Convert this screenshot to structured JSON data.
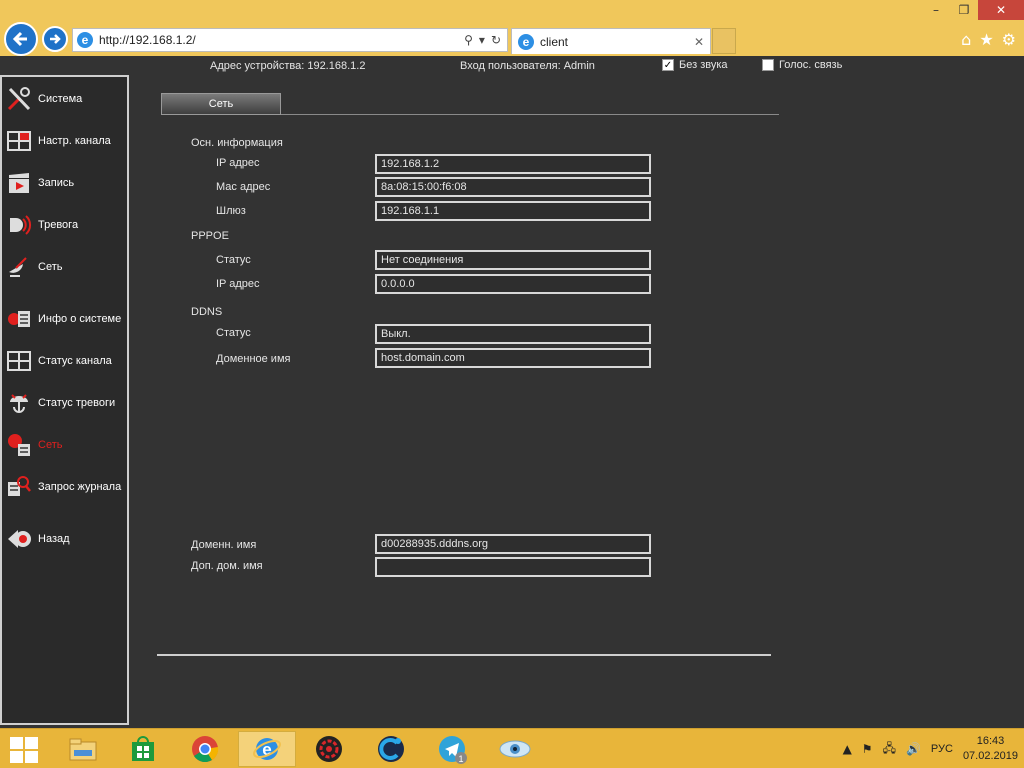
{
  "browser": {
    "address_url": "http://192.168.1.2/",
    "tab_title": "client",
    "window_controls": {
      "minimize": "–",
      "restore": "❐",
      "close": "✕"
    },
    "icons": [
      "home-icon",
      "star-icon",
      "gear-icon"
    ]
  },
  "topbar": {
    "device_address": "Адрес устройства: 192.168.1.2",
    "user_login": "Вход пользователя: Admin",
    "mute_label": "Без звука",
    "mute_checked": true,
    "voice_label": "Голос. связь",
    "voice_checked": false
  },
  "sidebar": {
    "items": [
      {
        "label": "Система",
        "icon": "tools-icon"
      },
      {
        "label": "Настр. канала",
        "icon": "channel-grid-icon"
      },
      {
        "label": "Запись",
        "icon": "clapper-icon"
      },
      {
        "label": "Тревога",
        "icon": "alarm-icon"
      },
      {
        "label": "Сеть",
        "icon": "satellite-icon"
      },
      {
        "label": "Инфо о системе",
        "icon": "system-info-icon"
      },
      {
        "label": "Статус канала",
        "icon": "channel-status-icon"
      },
      {
        "label": "Статус тревоги",
        "icon": "alarm-status-icon"
      },
      {
        "label": "Сеть",
        "icon": "network-globe-icon",
        "active": true
      },
      {
        "label": "Запрос журнала",
        "icon": "log-search-icon"
      },
      {
        "label": "Назад",
        "icon": "back-icon"
      }
    ]
  },
  "main": {
    "tab_label": "Сеть",
    "basic_info": {
      "title": "Осн. информация",
      "ip_label": "IP адрес",
      "ip_value": "192.168.1.2",
      "mac_label": "Мас адрес",
      "mac_value": "8a:08:15:00:f6:08",
      "gateway_label": "Шлюз",
      "gateway_value": "192.168.1.1"
    },
    "pppoe": {
      "title": "PPPOE",
      "status_label": "Статус",
      "status_value": "Нет соединения",
      "ip_label": "IP адрес",
      "ip_value": "0.0.0.0"
    },
    "ddns": {
      "title": "DDNS",
      "status_label": "Статус",
      "status_value": "Выкл.",
      "domain_label": "Доменное имя",
      "domain_value": "host.domain.com"
    },
    "extra": {
      "domain_label": "Доменн. имя",
      "domain_value": "d00288935.dddns.org",
      "alt_domain_label": "Доп. дом. имя",
      "alt_domain_value": ""
    }
  },
  "taskbar": {
    "apps": [
      "file-explorer-icon",
      "store-icon",
      "chrome-icon",
      "internet-explorer-icon",
      "gear-app-icon",
      "ccleaner-icon",
      "telegram-icon",
      "eye-app-icon"
    ],
    "telegram_badge": "1",
    "language": "РУС",
    "time": "16:43",
    "date": "07.02.2019"
  },
  "colors": {
    "chrome_bg": "#f0c75b",
    "page_bg": "#333333",
    "active_menu": "#e0201e",
    "taskbar_bg": "#e8b53a"
  }
}
